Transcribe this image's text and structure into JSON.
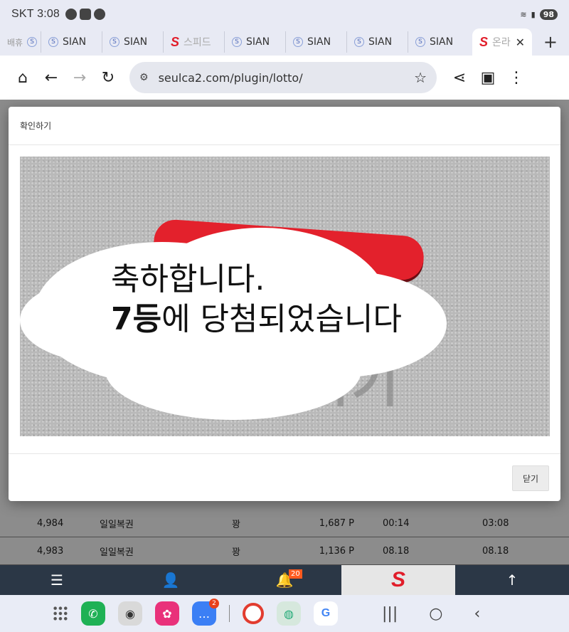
{
  "status_bar": {
    "carrier": "SKT",
    "time": "3:08",
    "battery": "98"
  },
  "tabs": [
    {
      "label": "배휴 ",
      "favicon": "sian-logo"
    },
    {
      "label": "SIAN",
      "favicon": "sian-logo"
    },
    {
      "label": "SIAN",
      "favicon": "sian-logo"
    },
    {
      "label": "스피드",
      "favicon": "red-s-logo"
    },
    {
      "label": "SIAN",
      "favicon": "sian-logo"
    },
    {
      "label": "SIAN",
      "favicon": "sian-logo"
    },
    {
      "label": "SIAN",
      "favicon": "sian-logo"
    },
    {
      "label": "SIAN",
      "favicon": "sian-logo"
    },
    {
      "label": "온라",
      "favicon": "red-s-logo",
      "active": true
    }
  ],
  "address_bar": {
    "url": "seulca2.com/plugin/lotto/"
  },
  "modal": {
    "title": "확인하기",
    "message_line1": "축하합니다.",
    "message_line2_bold": "7등",
    "message_line2_rest": "에 당첨되었습니다",
    "close_label": "닫기"
  },
  "table": {
    "rows": [
      {
        "num": "4,984",
        "game": "일일복권",
        "result": "꽝",
        "points": "1,687 P",
        "time1": "00:14",
        "time2": "03:08"
      },
      {
        "num": "4,983",
        "game": "일일복권",
        "result": "꽝",
        "points": "1,136 P",
        "time1": "08.18",
        "time2": "08.18"
      }
    ]
  },
  "bottom_nav": {
    "notification_count": "20"
  },
  "dock": {
    "messages_badge": "2"
  },
  "colors": {
    "brand_red": "#e11d2a",
    "nav_dark": "#2b3746",
    "badge_orange": "#ff5a1f"
  }
}
